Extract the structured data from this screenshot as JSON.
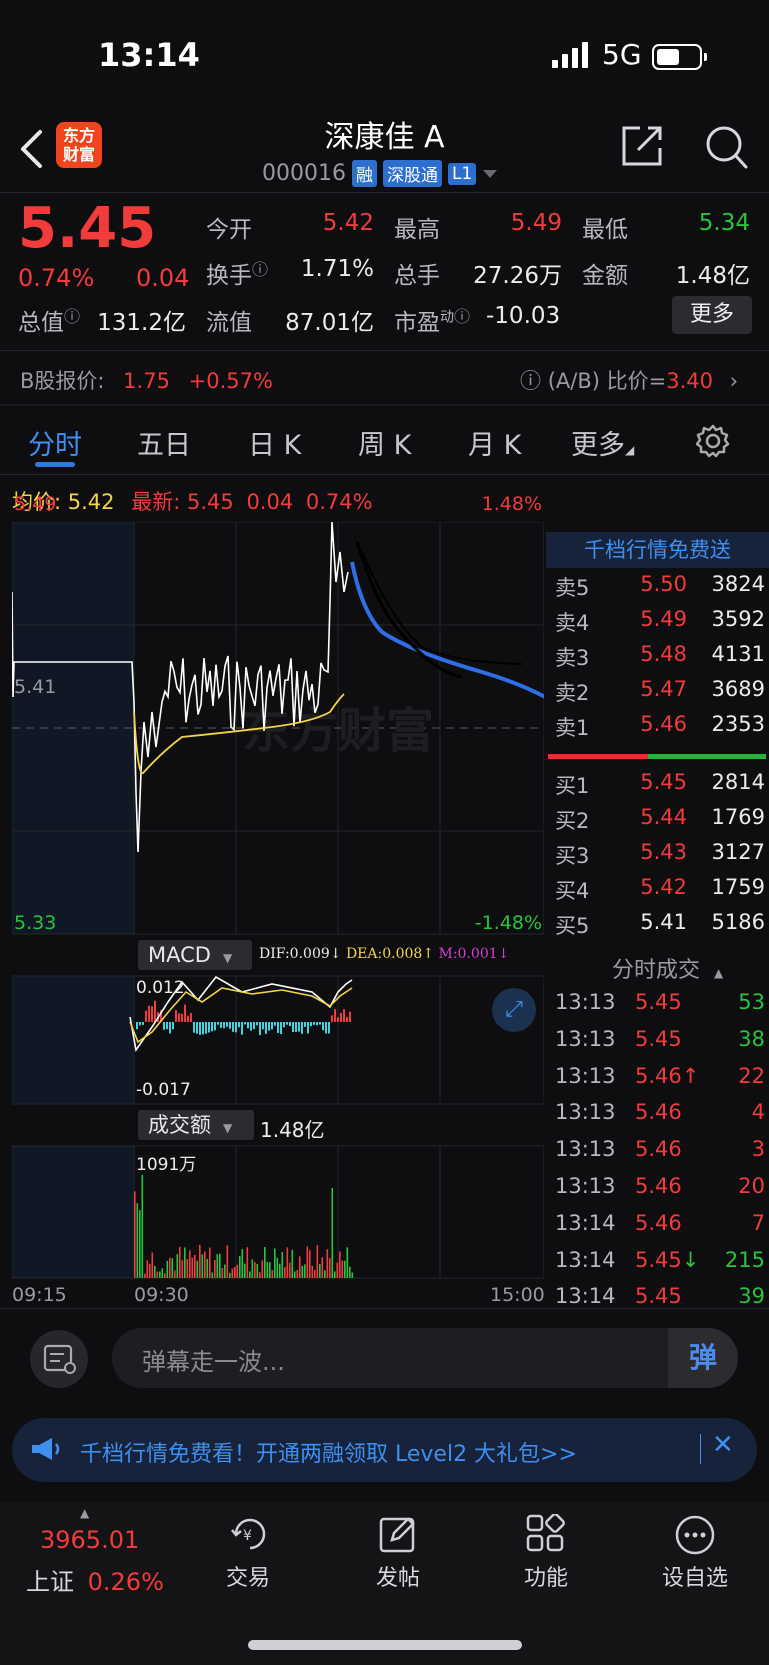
{
  "status_bar": {
    "time": "13:14",
    "network": "5G"
  },
  "header": {
    "logo_line1": "东方",
    "logo_line2": "财富",
    "stock_name": "深康佳 A",
    "code": "000016",
    "tags": [
      "融",
      "深股通",
      "L1"
    ]
  },
  "quote": {
    "price": "5.45",
    "change_pct": "0.74%",
    "change_amt": "0.04",
    "open_label": "今开",
    "open": "5.42",
    "high_label": "最高",
    "high": "5.49",
    "low_label": "最低",
    "low": "5.34",
    "turnover_label": "换手",
    "turnover": "1.71%",
    "volume_label": "总手",
    "volume": "27.26万",
    "amount_label": "金额",
    "amount": "1.48亿",
    "mktcap_label": "总值",
    "mktcap": "131.2亿",
    "float_label": "流值",
    "float_cap": "87.01亿",
    "pe_label": "市盈",
    "pe_sup": "动",
    "pe": "-10.03",
    "more_label": "更多"
  },
  "bshare": {
    "label": "B股报价:",
    "price": "1.75",
    "change": "+0.57%",
    "ratio_label": "(A/B) 比价=",
    "ratio": "3.40"
  },
  "tabs": [
    "分时",
    "五日",
    "日 K",
    "周 K",
    "月 K",
    "更多"
  ],
  "avg_row": {
    "avg_label": "均价:",
    "avg": "5.42",
    "latest_label": "最新:",
    "latest": "5.45",
    "chg": "0.04",
    "pct": "0.74%"
  },
  "intraday": {
    "y_max": "5.49",
    "y_mid": "5.41",
    "y_min": "5.33",
    "pct_max": "1.48%",
    "pct_min": "-1.48%",
    "watermark": "东方财富",
    "times": [
      "09:15",
      "09:30",
      "15:00"
    ]
  },
  "macd": {
    "label": "MACD",
    "dif": "DIF:0.009",
    "dea": "DEA:0.008",
    "m": "M:0.001",
    "top": "0.012",
    "bottom": "-0.017"
  },
  "volume_panel": {
    "label": "成交额",
    "total": "1.48亿",
    "max": "1091万"
  },
  "orderbook": {
    "title": "千档行情免费送",
    "asks": [
      {
        "label": "卖5",
        "price": "5.50",
        "vol": "3824"
      },
      {
        "label": "卖4",
        "price": "5.49",
        "vol": "3592"
      },
      {
        "label": "卖3",
        "price": "5.48",
        "vol": "4131"
      },
      {
        "label": "卖2",
        "price": "5.47",
        "vol": "3689"
      },
      {
        "label": "卖1",
        "price": "5.46",
        "vol": "2353"
      }
    ],
    "bids": [
      {
        "label": "买1",
        "price": "5.45",
        "vol": "2814"
      },
      {
        "label": "买2",
        "price": "5.44",
        "vol": "1769"
      },
      {
        "label": "买3",
        "price": "5.43",
        "vol": "3127"
      },
      {
        "label": "买4",
        "price": "5.42",
        "vol": "1759"
      },
      {
        "label": "买5",
        "price": "5.41",
        "vol": "5186"
      }
    ]
  },
  "trades": {
    "title": "分时成交",
    "rows": [
      {
        "time": "13:13",
        "price": "5.45",
        "vol": "53",
        "dir": ""
      },
      {
        "time": "13:13",
        "price": "5.45",
        "vol": "38",
        "dir": ""
      },
      {
        "time": "13:13",
        "price": "5.46",
        "vol": "22",
        "dir": "↑"
      },
      {
        "time": "13:13",
        "price": "5.46",
        "vol": "4",
        "dir": ""
      },
      {
        "time": "13:13",
        "price": "5.46",
        "vol": "3",
        "dir": ""
      },
      {
        "time": "13:13",
        "price": "5.46",
        "vol": "20",
        "dir": ""
      },
      {
        "time": "13:14",
        "price": "5.46",
        "vol": "7",
        "dir": ""
      },
      {
        "time": "13:14",
        "price": "5.45",
        "vol": "215",
        "dir": "↓"
      },
      {
        "time": "13:14",
        "price": "5.45",
        "vol": "39",
        "dir": ""
      }
    ]
  },
  "danmu": {
    "placeholder": "弹幕走一波...",
    "button": "弹"
  },
  "banner": {
    "text": "千档行情免费看！开通两融领取 Level2 大礼包>>"
  },
  "bottom_nav": {
    "index_value": "3965.01",
    "index_name": "上证",
    "index_pct": "0.26%",
    "items": [
      "交易",
      "发帖",
      "功能",
      "设自选"
    ]
  },
  "colors": {
    "up": "#f23b3b",
    "down": "#27c43c",
    "accent": "#2d7ae0",
    "avg_line": "#f2d54a"
  }
}
